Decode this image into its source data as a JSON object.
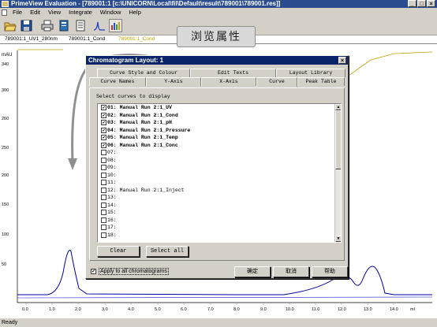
{
  "window": {
    "title": "PrimeView Evaluation - [789001:1    [c:\\UNICORN\\Local\\fil\\Default\\result\\789001\\789001.res]]",
    "controls": [
      "_",
      "□",
      "×"
    ]
  },
  "menu": [
    "File",
    "Edit",
    "View",
    "Integrate",
    "Window",
    "Help"
  ],
  "toolbar": {
    "icons": [
      "open-icon",
      "save-icon",
      "print-icon",
      "page-icon",
      "document-icon",
      "peak-icon",
      "chromatogram-layout-icon"
    ]
  },
  "curve_tabs": {
    "uv": "789001:1_UV1_280nm",
    "cond": "789001:1_Cond",
    "third": "789001:1_Cond"
  },
  "callout": {
    "text": "浏览属性"
  },
  "chart": {
    "yunit": "mAU",
    "ytick_labels": [
      "340",
      "300",
      "260",
      "250",
      "200",
      "150",
      "100",
      "50"
    ],
    "xtick_labels": [
      "0.0",
      "1.0",
      "2.0",
      "3.0",
      "4.0",
      "5.0",
      "6.0",
      "7.0",
      "8.0",
      "9.0",
      "10.0",
      "11.0",
      "12.0",
      "13.0",
      "14.0",
      "ml"
    ]
  },
  "dialog": {
    "title": "Chromatogram Layout: 1",
    "tabs_row1": [
      "Curve Style and Colour",
      "Edit Texts",
      "Layout Library"
    ],
    "tabs_row2": [
      "Curve Names",
      "Y-Axis",
      "X-Axis",
      "Curve",
      "Peak Table"
    ],
    "active_tab": "Curve",
    "section_label": "Select curves to display",
    "curves": [
      {
        "label": "01: Manual Run 2:1_UV",
        "checked": "✔"
      },
      {
        "label": "02: Manual Run 2:1_Cond",
        "checked": "✔"
      },
      {
        "label": "03: Manual Run 2:1_pH",
        "checked": "✔"
      },
      {
        "label": "04: Manual Run 2:1_Pressure",
        "checked": "✔"
      },
      {
        "label": "05: Manual Run 2:1_Temp",
        "checked": "✔"
      },
      {
        "label": "06: Manual Run 2:1_Conc",
        "checked": "✔"
      },
      {
        "label": "07:",
        "checked": ""
      },
      {
        "label": "08:",
        "checked": ""
      },
      {
        "label": "09:",
        "checked": ""
      },
      {
        "label": "10:",
        "checked": ""
      },
      {
        "label": "11:",
        "checked": ""
      },
      {
        "label": "12: Manual Run 2:1_Inject",
        "checked": ""
      },
      {
        "label": "13:",
        "checked": ""
      },
      {
        "label": "14:",
        "checked": ""
      },
      {
        "label": "15:",
        "checked": ""
      },
      {
        "label": "16:",
        "checked": ""
      },
      {
        "label": "17:",
        "checked": ""
      },
      {
        "label": "18:",
        "checked": ""
      }
    ],
    "clear_label": "Clear",
    "select_all_label": "Select all",
    "apply_all_label": "Apply to all chromatograms",
    "apply_all_checked": "✔",
    "ok_label": "确定",
    "cancel_label": "取消",
    "help_label": "帮助"
  },
  "status": {
    "text": "Ready"
  }
}
